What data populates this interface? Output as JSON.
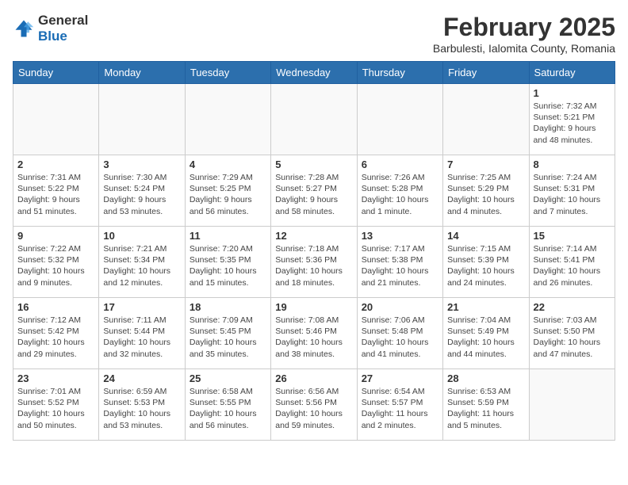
{
  "header": {
    "logo_line1": "General",
    "logo_line2": "Blue",
    "month": "February 2025",
    "location": "Barbulesti, Ialomita County, Romania"
  },
  "days_of_week": [
    "Sunday",
    "Monday",
    "Tuesday",
    "Wednesday",
    "Thursday",
    "Friday",
    "Saturday"
  ],
  "weeks": [
    [
      {
        "day": "",
        "info": ""
      },
      {
        "day": "",
        "info": ""
      },
      {
        "day": "",
        "info": ""
      },
      {
        "day": "",
        "info": ""
      },
      {
        "day": "",
        "info": ""
      },
      {
        "day": "",
        "info": ""
      },
      {
        "day": "1",
        "info": "Sunrise: 7:32 AM\nSunset: 5:21 PM\nDaylight: 9 hours and 48 minutes."
      }
    ],
    [
      {
        "day": "2",
        "info": "Sunrise: 7:31 AM\nSunset: 5:22 PM\nDaylight: 9 hours and 51 minutes."
      },
      {
        "day": "3",
        "info": "Sunrise: 7:30 AM\nSunset: 5:24 PM\nDaylight: 9 hours and 53 minutes."
      },
      {
        "day": "4",
        "info": "Sunrise: 7:29 AM\nSunset: 5:25 PM\nDaylight: 9 hours and 56 minutes."
      },
      {
        "day": "5",
        "info": "Sunrise: 7:28 AM\nSunset: 5:27 PM\nDaylight: 9 hours and 58 minutes."
      },
      {
        "day": "6",
        "info": "Sunrise: 7:26 AM\nSunset: 5:28 PM\nDaylight: 10 hours and 1 minute."
      },
      {
        "day": "7",
        "info": "Sunrise: 7:25 AM\nSunset: 5:29 PM\nDaylight: 10 hours and 4 minutes."
      },
      {
        "day": "8",
        "info": "Sunrise: 7:24 AM\nSunset: 5:31 PM\nDaylight: 10 hours and 7 minutes."
      }
    ],
    [
      {
        "day": "9",
        "info": "Sunrise: 7:22 AM\nSunset: 5:32 PM\nDaylight: 10 hours and 9 minutes."
      },
      {
        "day": "10",
        "info": "Sunrise: 7:21 AM\nSunset: 5:34 PM\nDaylight: 10 hours and 12 minutes."
      },
      {
        "day": "11",
        "info": "Sunrise: 7:20 AM\nSunset: 5:35 PM\nDaylight: 10 hours and 15 minutes."
      },
      {
        "day": "12",
        "info": "Sunrise: 7:18 AM\nSunset: 5:36 PM\nDaylight: 10 hours and 18 minutes."
      },
      {
        "day": "13",
        "info": "Sunrise: 7:17 AM\nSunset: 5:38 PM\nDaylight: 10 hours and 21 minutes."
      },
      {
        "day": "14",
        "info": "Sunrise: 7:15 AM\nSunset: 5:39 PM\nDaylight: 10 hours and 24 minutes."
      },
      {
        "day": "15",
        "info": "Sunrise: 7:14 AM\nSunset: 5:41 PM\nDaylight: 10 hours and 26 minutes."
      }
    ],
    [
      {
        "day": "16",
        "info": "Sunrise: 7:12 AM\nSunset: 5:42 PM\nDaylight: 10 hours and 29 minutes."
      },
      {
        "day": "17",
        "info": "Sunrise: 7:11 AM\nSunset: 5:44 PM\nDaylight: 10 hours and 32 minutes."
      },
      {
        "day": "18",
        "info": "Sunrise: 7:09 AM\nSunset: 5:45 PM\nDaylight: 10 hours and 35 minutes."
      },
      {
        "day": "19",
        "info": "Sunrise: 7:08 AM\nSunset: 5:46 PM\nDaylight: 10 hours and 38 minutes."
      },
      {
        "day": "20",
        "info": "Sunrise: 7:06 AM\nSunset: 5:48 PM\nDaylight: 10 hours and 41 minutes."
      },
      {
        "day": "21",
        "info": "Sunrise: 7:04 AM\nSunset: 5:49 PM\nDaylight: 10 hours and 44 minutes."
      },
      {
        "day": "22",
        "info": "Sunrise: 7:03 AM\nSunset: 5:50 PM\nDaylight: 10 hours and 47 minutes."
      }
    ],
    [
      {
        "day": "23",
        "info": "Sunrise: 7:01 AM\nSunset: 5:52 PM\nDaylight: 10 hours and 50 minutes."
      },
      {
        "day": "24",
        "info": "Sunrise: 6:59 AM\nSunset: 5:53 PM\nDaylight: 10 hours and 53 minutes."
      },
      {
        "day": "25",
        "info": "Sunrise: 6:58 AM\nSunset: 5:55 PM\nDaylight: 10 hours and 56 minutes."
      },
      {
        "day": "26",
        "info": "Sunrise: 6:56 AM\nSunset: 5:56 PM\nDaylight: 10 hours and 59 minutes."
      },
      {
        "day": "27",
        "info": "Sunrise: 6:54 AM\nSunset: 5:57 PM\nDaylight: 11 hours and 2 minutes."
      },
      {
        "day": "28",
        "info": "Sunrise: 6:53 AM\nSunset: 5:59 PM\nDaylight: 11 hours and 5 minutes."
      },
      {
        "day": "",
        "info": ""
      }
    ]
  ]
}
